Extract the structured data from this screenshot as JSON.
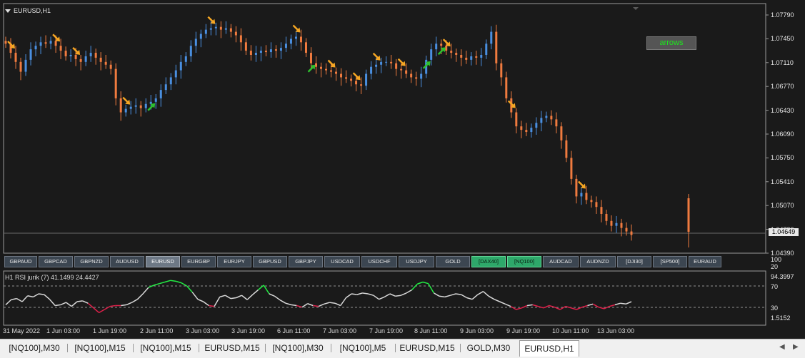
{
  "window": {
    "chart_title": "EURUSD,H1",
    "arrows_button_label": "arrows",
    "current_price": "1.04649"
  },
  "price_axis": [
    "1.07790",
    "1.07450",
    "1.07110",
    "1.06770",
    "1.06430",
    "1.06090",
    "1.05750",
    "1.05410",
    "1.05070",
    "1.04730",
    "1.04390"
  ],
  "symbol_buttons": [
    {
      "label": "GBPAUD",
      "state": "normal"
    },
    {
      "label": "GBPCAD",
      "state": "normal"
    },
    {
      "label": "GBPNZD",
      "state": "normal"
    },
    {
      "label": "AUDUSD",
      "state": "normal"
    },
    {
      "label": "EURUSD",
      "state": "active"
    },
    {
      "label": "EURGBP",
      "state": "normal"
    },
    {
      "label": "EURJPY",
      "state": "normal"
    },
    {
      "label": "GBPUSD",
      "state": "normal"
    },
    {
      "label": "GBPJPY",
      "state": "normal"
    },
    {
      "label": "USDCAD",
      "state": "normal"
    },
    {
      "label": "USDCHF",
      "state": "normal"
    },
    {
      "label": "USDJPY",
      "state": "normal"
    },
    {
      "label": "GOLD",
      "state": "normal"
    },
    {
      "label": "[DAX40]",
      "state": "green"
    },
    {
      "label": "[NQ100]",
      "state": "green"
    },
    {
      "label": "AUDCAD",
      "state": "normal"
    },
    {
      "label": "AUDNZD",
      "state": "normal"
    },
    {
      "label": "[DJI30]",
      "state": "normal"
    },
    {
      "label": "[SP500]",
      "state": "normal"
    },
    {
      "label": "EURAUD",
      "state": "normal"
    }
  ],
  "indicator": {
    "label": "H1  RSI jurik (7) 41.1499 24.4427",
    "scale": [
      "100",
      "20",
      "94.3997",
      "70",
      "30",
      "1.5152"
    ]
  },
  "time_axis": [
    "31 May 2022",
    "1 Jun 03:00",
    "1 Jun 19:00",
    "2 Jun 11:00",
    "3 Jun 03:00",
    "3 Jun 19:00",
    "6 Jun 11:00",
    "7 Jun 03:00",
    "7 Jun 19:00",
    "8 Jun 11:00",
    "9 Jun 03:00",
    "9 Jun 19:00",
    "10 Jun 11:00",
    "13 Jun 03:00"
  ],
  "tabs": [
    {
      "label": "[NQ100],M30",
      "active": false
    },
    {
      "label": "[NQ100],M15",
      "active": false
    },
    {
      "label": "[NQ100],M15",
      "active": false
    },
    {
      "label": "EURUSD,M15",
      "active": false
    },
    {
      "label": "[NQ100],M30",
      "active": false
    },
    {
      "label": "[NQ100],M5",
      "active": false
    },
    {
      "label": "EURUSD,M15",
      "active": false
    },
    {
      "label": "GOLD,M30",
      "active": false
    },
    {
      "label": "EURUSD,H1",
      "active": true
    }
  ],
  "colors": {
    "bull": "#4a8fe0",
    "bear": "#f07b3f",
    "arrow_down": "#f5a623",
    "arrow_up": "#2ec02e",
    "rsi_overbought": "#22ee44",
    "rsi_oversold": "#e0204a",
    "rsi_neutral": "#d9d9d9"
  },
  "chart_data": {
    "type": "candlestick",
    "title": "EURUSD,H1",
    "ylim": [
      1.0439,
      1.0779
    ],
    "close_series": [
      1.0738,
      1.0725,
      1.0712,
      1.0698,
      1.0715,
      1.073,
      1.0735,
      1.074,
      1.0738,
      1.0742,
      1.0735,
      1.0728,
      1.072,
      1.0722,
      1.0716,
      1.0712,
      1.072,
      1.0725,
      1.0718,
      1.0712,
      1.0708,
      1.0702,
      1.066,
      1.064,
      1.0645,
      1.0648,
      1.065,
      1.0646,
      1.0652,
      1.0655,
      1.066,
      1.0672,
      1.068,
      1.069,
      1.07,
      1.0712,
      1.072,
      1.0735,
      1.0745,
      1.0752,
      1.0758,
      1.076,
      1.0762,
      1.0758,
      1.076,
      1.0755,
      1.075,
      1.074,
      1.0728,
      1.0722,
      1.0725,
      1.0728,
      1.0726,
      1.073,
      1.0728,
      1.0732,
      1.0738,
      1.0745,
      1.0748,
      1.074,
      1.0725,
      1.071,
      1.0705,
      1.0702,
      1.07,
      1.0698,
      1.0695,
      1.069,
      1.0688,
      1.0685,
      1.068,
      1.0678,
      1.0695,
      1.0705,
      1.0708,
      1.0712,
      1.0712,
      1.071,
      1.0702,
      1.07,
      1.0695,
      1.069,
      1.0688,
      1.0695,
      1.0715,
      1.073,
      1.0738,
      1.0735,
      1.0728,
      1.0725,
      1.0722,
      1.0718,
      1.0715,
      1.072,
      1.0718,
      1.0722,
      1.0738,
      1.0755,
      1.071,
      1.069,
      1.066,
      1.064,
      1.062,
      1.0615,
      1.0612,
      1.0618,
      1.0625,
      1.0632,
      1.0635,
      1.063,
      1.062,
      1.06,
      1.0575,
      1.0545,
      1.052,
      1.0525,
      1.0515,
      1.0512,
      1.0505,
      1.0495,
      1.0485,
      1.0478,
      1.0482,
      1.0475,
      1.047,
      1.0465
    ],
    "down_arrows": [
      1,
      10,
      14,
      24,
      41,
      58,
      65,
      70,
      74,
      79,
      88,
      101,
      115,
      128
    ],
    "up_arrows": [
      29,
      61,
      84,
      87
    ],
    "rsi_ylim": [
      0,
      100
    ],
    "rsi_levels": [
      70,
      30
    ],
    "rsi_series": [
      32,
      45,
      48,
      40,
      55,
      52,
      60,
      58,
      46,
      30,
      32,
      38,
      28,
      40,
      42,
      36,
      24,
      12,
      20,
      28,
      30,
      30,
      32,
      38,
      46,
      60,
      76,
      82,
      86,
      90,
      94,
      92,
      88,
      80,
      64,
      46,
      40,
      30,
      28,
      52,
      56,
      48,
      50,
      56,
      45,
      58,
      70,
      82,
      60,
      54,
      44,
      36,
      32,
      30,
      26,
      35,
      30,
      28,
      34,
      38,
      36,
      30,
      50,
      60,
      58,
      62,
      60,
      56,
      46,
      52,
      60,
      54,
      56,
      62,
      70,
      85,
      90,
      86,
      62,
      54,
      52,
      56,
      60,
      58,
      50,
      46,
      58,
      66,
      54,
      46,
      40,
      34,
      28,
      20,
      24,
      30,
      32,
      28,
      24,
      30,
      26,
      20,
      28,
      24,
      20,
      26,
      30,
      34,
      26,
      22,
      28,
      32,
      36,
      34,
      40
    ]
  }
}
